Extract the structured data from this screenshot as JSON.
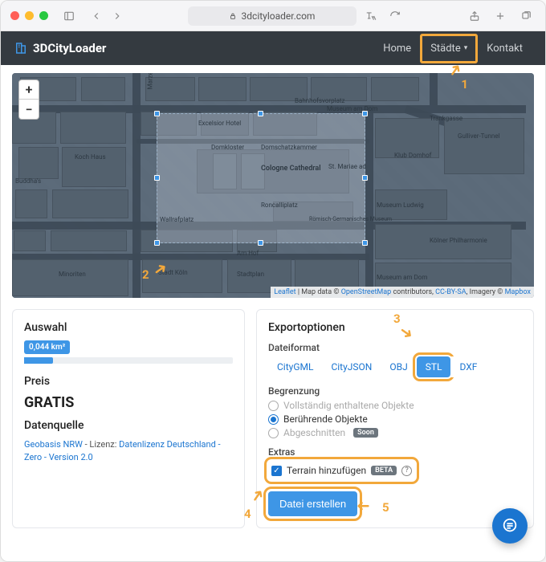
{
  "browser": {
    "url_host": "3dcityloader.com"
  },
  "brand": "3DCityLoader",
  "nav": {
    "home": "Home",
    "cities": "Städte",
    "contact": "Kontakt"
  },
  "map": {
    "zoom_in": "+",
    "zoom_out": "−",
    "attribution": {
      "leaflet": "Leaflet",
      "map_data_prefix": " | Map data © ",
      "osm": "OpenStreetMap",
      "contributors": " contributors, ",
      "ccbysa": "CC-BY-SA",
      "imagery_prefix": ", Imagery © ",
      "mapbox": "Mapbox"
    },
    "labels": {
      "cathedral": "Cologne Cathedral",
      "domschatz": "Domschatzkammer",
      "domkloster": "Domkloster",
      "roncalli": "Roncalliplatz",
      "am_hof": "Am Hof",
      "wallraf": "Wallrafplatz",
      "bahnhof": "Bahnhofsvorplatz",
      "museum_ludwig": "Museum Ludwig",
      "rgm": "Römisch-Germanisches Museum",
      "philharmonie": "Kölner Philharmonie",
      "gulliver": "Gulliver-Tunnel",
      "st_mariae": "St. Mariae ad",
      "museum_dom": "Museum am Dom",
      "excelsior": "Excelsior Hotel",
      "trankgasse": "Trankgasse",
      "buddhas": "Buddha's",
      "kochhaus": "Koch Haus",
      "minoriten": "Minoriten",
      "stadt_koeln": "Stadt Köln",
      "stadtplan": "Stadtplan",
      "marzellen": "Marzellenstraße",
      "klubdom": "Klub Domhof"
    }
  },
  "left": {
    "selection_title": "Auswahl",
    "area_value": "0,044 km²",
    "price_title": "Preis",
    "price_value": "GRATIS",
    "source_title": "Datenquelle",
    "source_link": "Geobasis NRW",
    "source_sep": " - Lizenz: ",
    "license_link": "Datenlizenz Deutschland - Zero - Version 2.0"
  },
  "right": {
    "title": "Exportoptionen",
    "format_title": "Dateiformat",
    "formats": {
      "citygml": "CityGML",
      "cityjson": "CityJSON",
      "obj": "OBJ",
      "stl": "STL",
      "dxf": "DXF"
    },
    "bound_title": "Begrenzung",
    "bound_full": "Vollständig enthaltene Objekte",
    "bound_touch": "Berührende Objekte",
    "bound_cut": "Abgeschnitten",
    "soon": "Soon",
    "extras_title": "Extras",
    "terrain_label": "Terrain hinzufügen",
    "beta": "BETA",
    "create_btn": "Datei erstellen"
  },
  "annotations": {
    "n1": "1",
    "n2": "2",
    "n3": "3",
    "n4": "4",
    "n5": "5"
  }
}
